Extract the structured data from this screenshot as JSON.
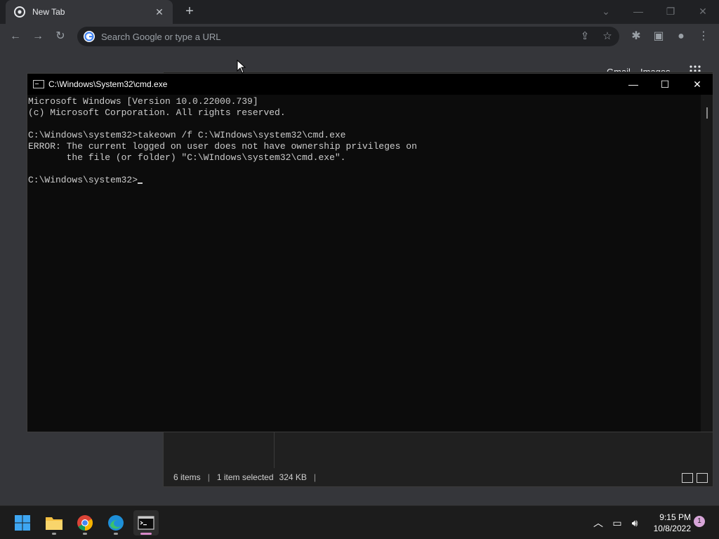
{
  "browser": {
    "tab_title": "New Tab",
    "tab_close": "✕",
    "new_tab": "+",
    "omnibox_placeholder": "Search Google or type a URL",
    "gmail": "Gmail",
    "images": "Images"
  },
  "cmd": {
    "title": "C:\\Windows\\System32\\cmd.exe",
    "lines": [
      "Microsoft Windows [Version 10.0.22000.739]",
      "(c) Microsoft Corporation. All rights reserved.",
      "",
      "C:\\Windows\\system32>takeown /f C:\\WIndows\\system32\\cmd.exe",
      "ERROR: The current logged on user does not have ownership privileges on",
      "       the file (or folder) \"C:\\WIndows\\system32\\cmd.exe\".",
      "",
      "C:\\Windows\\system32>"
    ]
  },
  "explorer": {
    "status_items": "6 items",
    "status_selected": "1 item selected",
    "status_size": "324 KB"
  },
  "taskbar": {
    "time": "9:15 PM",
    "date": "10/8/2022",
    "notification_count": "1",
    "pinned": [
      "start",
      "file-explorer",
      "chrome",
      "edge",
      "terminal"
    ]
  },
  "colors": {
    "accent": "#d889c8",
    "cmd_bg": "#0c0c0c",
    "cmd_text": "#cccccc"
  }
}
